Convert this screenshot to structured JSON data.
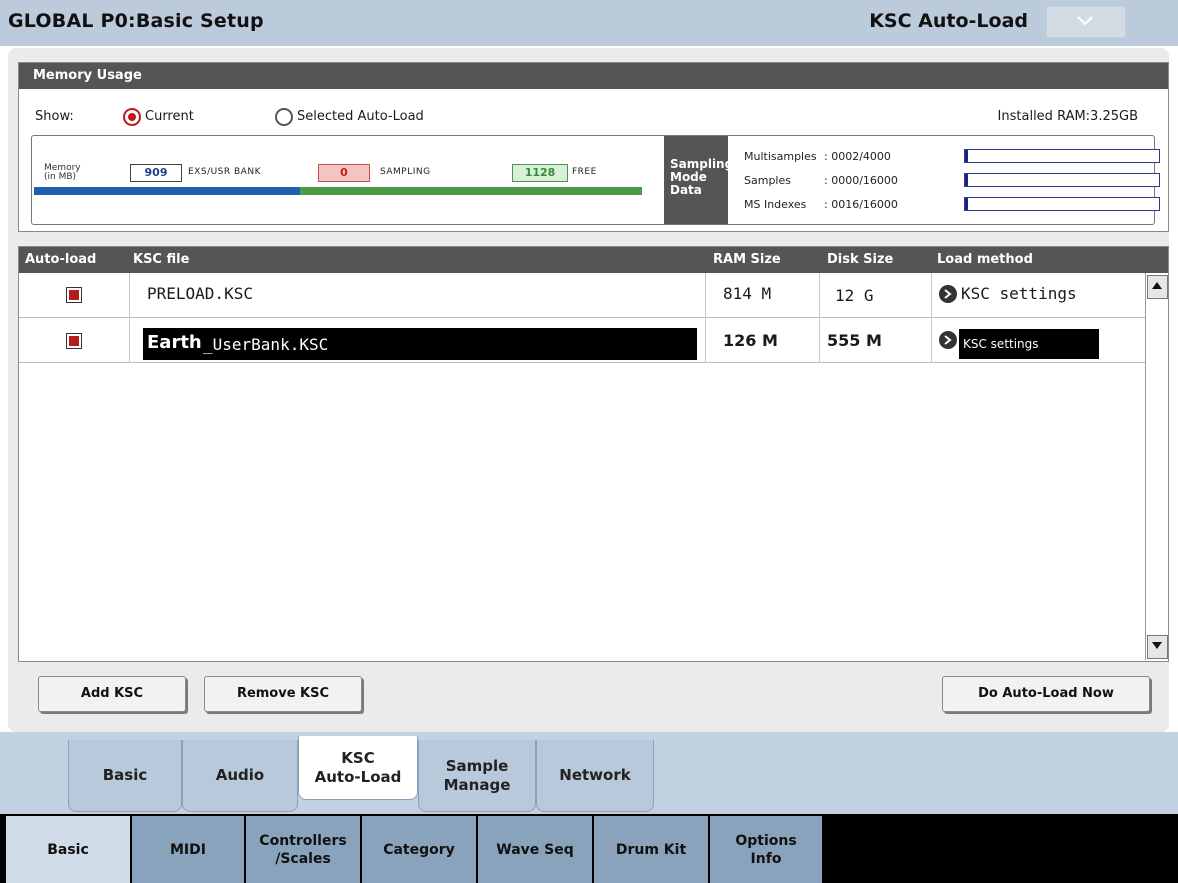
{
  "header": {
    "title": "GLOBAL P0:Basic Setup",
    "page_selector": "KSC Auto-Load"
  },
  "memory": {
    "section_title": "Memory Usage",
    "show_label": "Show:",
    "show_options": [
      "Current",
      "Selected Auto-Load"
    ],
    "show_selected": "Current",
    "installed_ram": "Installed RAM:3.25GB",
    "chart_label_line1": "Memory",
    "chart_label_line2": "(in MB)",
    "exs_value": "909",
    "exs_label": "EXS/USR BANK",
    "sampling_value": "0",
    "sampling_label": "SAMPLING",
    "free_value": "1128",
    "free_label": "FREE",
    "sampling_mode_title": "Sampling Mode Data",
    "sampling_mode_rows": [
      {
        "label": "Multisamples",
        "value": ": 0002/4000"
      },
      {
        "label": "Samples",
        "value": ": 0000/16000"
      },
      {
        "label": "MS Indexes",
        "value": ": 0016/16000"
      }
    ],
    "colors": {
      "exs": "#1f5fb0",
      "sampling": "#e0b0b0",
      "free": "#4a9a4a"
    }
  },
  "table": {
    "columns": [
      "Auto-load",
      "KSC file",
      "RAM Size",
      "Disk Size",
      "Load method"
    ],
    "rows": [
      {
        "checked": true,
        "file": "PRELOAD.KSC",
        "ram": "814 M",
        "disk": "12 G",
        "method": "KSC settings"
      },
      {
        "checked": true,
        "file_part1": "Earth",
        "file_part2": "_UserBank.KSC",
        "ram": "126 M",
        "disk": "555 M",
        "method": "KSC settings"
      }
    ]
  },
  "buttons": {
    "add": "Add KSC",
    "remove": "Remove KSC",
    "do_auto_load": "Do Auto-Load Now"
  },
  "tabs_upper": [
    {
      "label": "Basic",
      "active": false
    },
    {
      "label": "Audio",
      "active": false
    },
    {
      "label": "KSC\nAuto-Load",
      "active": true
    },
    {
      "label": "Sample\nManage",
      "active": false
    },
    {
      "label": "Network",
      "active": false
    }
  ],
  "tabs_lower": [
    {
      "label": "Basic",
      "active": true
    },
    {
      "label": "MIDI",
      "active": false
    },
    {
      "label": "Controllers\n/Scales",
      "active": false
    },
    {
      "label": "Category",
      "active": false
    },
    {
      "label": "Wave Seq",
      "active": false
    },
    {
      "label": "Drum Kit",
      "active": false
    },
    {
      "label": "Options\nInfo",
      "active": false
    }
  ]
}
